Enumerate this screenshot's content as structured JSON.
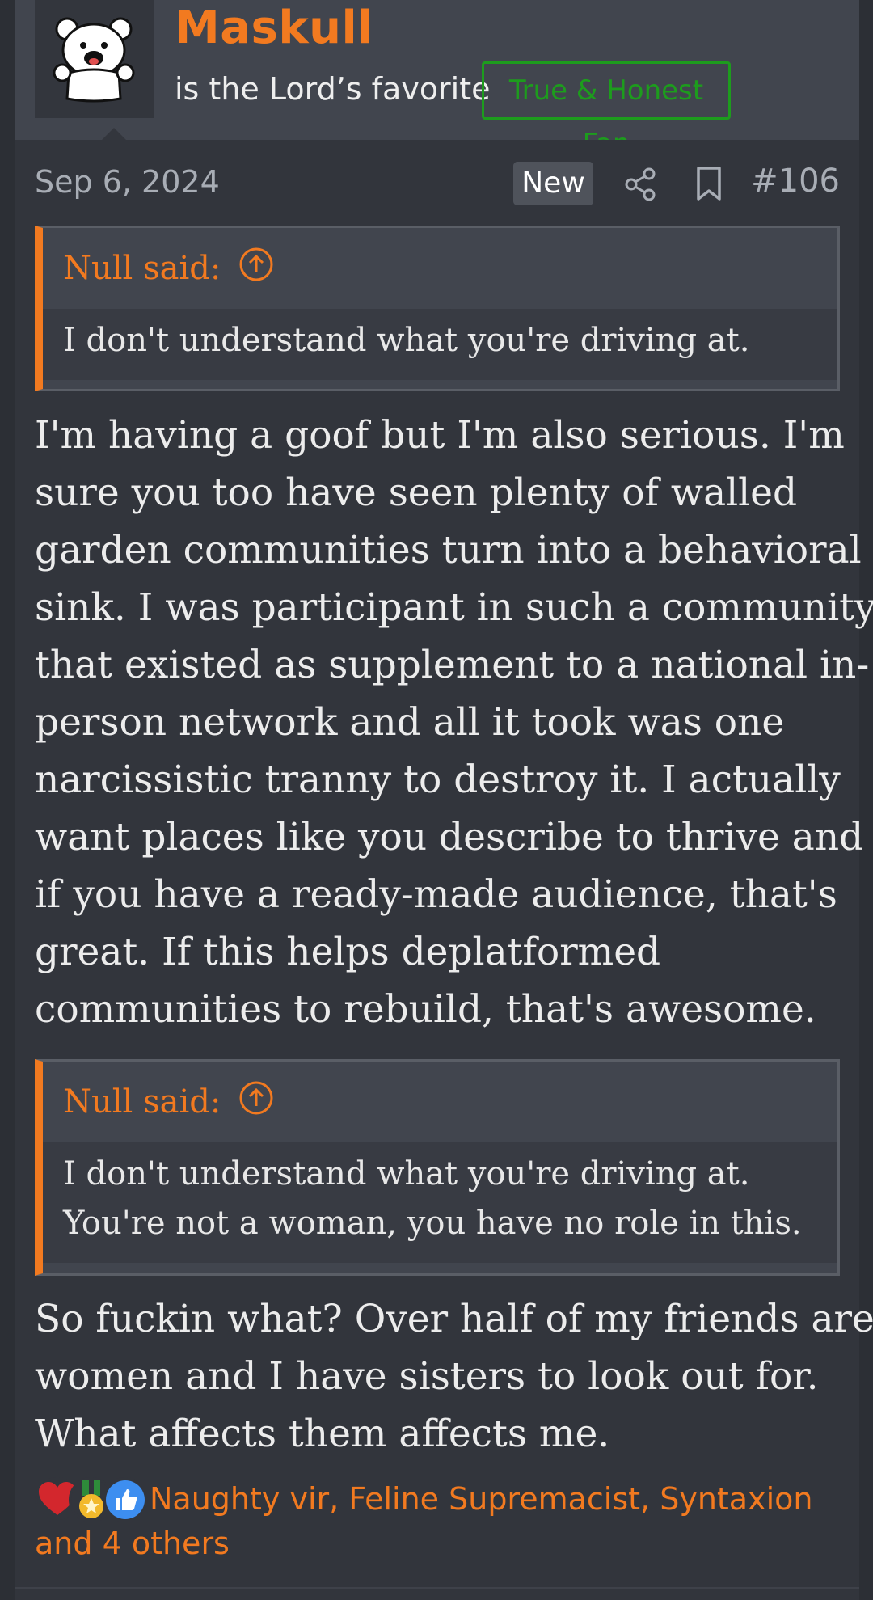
{
  "user": {
    "name": "Maskull",
    "title": "is the Lord’s favorite",
    "banner": "True & Honest Fan"
  },
  "post": {
    "date": "Sep 6, 2024",
    "new_badge": "New",
    "number": "#106"
  },
  "quote1": {
    "author": "Null said:",
    "lines": [
      "I don't understand what you're driving at."
    ]
  },
  "body1": {
    "lines": [
      "I'm having a goof but I'm also serious. I'm",
      "sure you too have seen plenty of walled",
      "garden communities turn into a behavioral",
      "sink. I was participant in such a community",
      "that existed as supplement to a national in-",
      "person network and all it took was one",
      "narcissistic tranny to destroy it. I actually",
      "want places like you describe to thrive and",
      "if you have a ready-made audience, that's",
      "great. If this helps deplatformed",
      "communities to rebuild, that's awesome."
    ]
  },
  "quote2": {
    "author": "Null said:",
    "lines": [
      "I don't understand what you're driving at.",
      "You're not a woman, you have no role in this."
    ]
  },
  "body2": {
    "lines": [
      "So fuckin what? Over half of my friends are",
      "women and I have sisters to look out for.",
      "What affects them affects me."
    ]
  },
  "reactions": {
    "icons": [
      "heart-icon",
      "medal-icon",
      "thumbs-up-icon"
    ],
    "names": "Naughty vir, Feline Supremacist, Syntaxion",
    "others": "and 4 others"
  },
  "colors": {
    "accent": "#f27a20",
    "banner_green": "#1d9c1d",
    "background": "#32353c",
    "header": "#41454e"
  }
}
